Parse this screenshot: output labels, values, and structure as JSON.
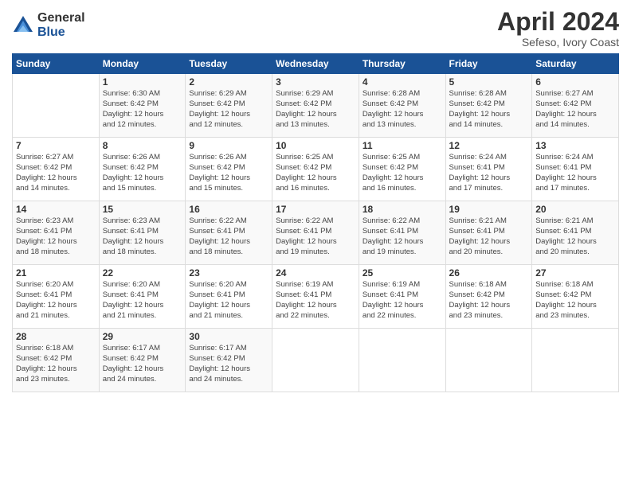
{
  "logo": {
    "general": "General",
    "blue": "Blue"
  },
  "title": "April 2024",
  "location": "Sefeso, Ivory Coast",
  "days_of_week": [
    "Sunday",
    "Monday",
    "Tuesday",
    "Wednesday",
    "Thursday",
    "Friday",
    "Saturday"
  ],
  "weeks": [
    [
      {
        "day": "",
        "info": ""
      },
      {
        "day": "1",
        "info": "Sunrise: 6:30 AM\nSunset: 6:42 PM\nDaylight: 12 hours\nand 12 minutes."
      },
      {
        "day": "2",
        "info": "Sunrise: 6:29 AM\nSunset: 6:42 PM\nDaylight: 12 hours\nand 12 minutes."
      },
      {
        "day": "3",
        "info": "Sunrise: 6:29 AM\nSunset: 6:42 PM\nDaylight: 12 hours\nand 13 minutes."
      },
      {
        "day": "4",
        "info": "Sunrise: 6:28 AM\nSunset: 6:42 PM\nDaylight: 12 hours\nand 13 minutes."
      },
      {
        "day": "5",
        "info": "Sunrise: 6:28 AM\nSunset: 6:42 PM\nDaylight: 12 hours\nand 14 minutes."
      },
      {
        "day": "6",
        "info": "Sunrise: 6:27 AM\nSunset: 6:42 PM\nDaylight: 12 hours\nand 14 minutes."
      }
    ],
    [
      {
        "day": "7",
        "info": "Sunrise: 6:27 AM\nSunset: 6:42 PM\nDaylight: 12 hours\nand 14 minutes."
      },
      {
        "day": "8",
        "info": "Sunrise: 6:26 AM\nSunset: 6:42 PM\nDaylight: 12 hours\nand 15 minutes."
      },
      {
        "day": "9",
        "info": "Sunrise: 6:26 AM\nSunset: 6:42 PM\nDaylight: 12 hours\nand 15 minutes."
      },
      {
        "day": "10",
        "info": "Sunrise: 6:25 AM\nSunset: 6:42 PM\nDaylight: 12 hours\nand 16 minutes."
      },
      {
        "day": "11",
        "info": "Sunrise: 6:25 AM\nSunset: 6:42 PM\nDaylight: 12 hours\nand 16 minutes."
      },
      {
        "day": "12",
        "info": "Sunrise: 6:24 AM\nSunset: 6:41 PM\nDaylight: 12 hours\nand 17 minutes."
      },
      {
        "day": "13",
        "info": "Sunrise: 6:24 AM\nSunset: 6:41 PM\nDaylight: 12 hours\nand 17 minutes."
      }
    ],
    [
      {
        "day": "14",
        "info": "Sunrise: 6:23 AM\nSunset: 6:41 PM\nDaylight: 12 hours\nand 18 minutes."
      },
      {
        "day": "15",
        "info": "Sunrise: 6:23 AM\nSunset: 6:41 PM\nDaylight: 12 hours\nand 18 minutes."
      },
      {
        "day": "16",
        "info": "Sunrise: 6:22 AM\nSunset: 6:41 PM\nDaylight: 12 hours\nand 18 minutes."
      },
      {
        "day": "17",
        "info": "Sunrise: 6:22 AM\nSunset: 6:41 PM\nDaylight: 12 hours\nand 19 minutes."
      },
      {
        "day": "18",
        "info": "Sunrise: 6:22 AM\nSunset: 6:41 PM\nDaylight: 12 hours\nand 19 minutes."
      },
      {
        "day": "19",
        "info": "Sunrise: 6:21 AM\nSunset: 6:41 PM\nDaylight: 12 hours\nand 20 minutes."
      },
      {
        "day": "20",
        "info": "Sunrise: 6:21 AM\nSunset: 6:41 PM\nDaylight: 12 hours\nand 20 minutes."
      }
    ],
    [
      {
        "day": "21",
        "info": "Sunrise: 6:20 AM\nSunset: 6:41 PM\nDaylight: 12 hours\nand 21 minutes."
      },
      {
        "day": "22",
        "info": "Sunrise: 6:20 AM\nSunset: 6:41 PM\nDaylight: 12 hours\nand 21 minutes."
      },
      {
        "day": "23",
        "info": "Sunrise: 6:20 AM\nSunset: 6:41 PM\nDaylight: 12 hours\nand 21 minutes."
      },
      {
        "day": "24",
        "info": "Sunrise: 6:19 AM\nSunset: 6:41 PM\nDaylight: 12 hours\nand 22 minutes."
      },
      {
        "day": "25",
        "info": "Sunrise: 6:19 AM\nSunset: 6:41 PM\nDaylight: 12 hours\nand 22 minutes."
      },
      {
        "day": "26",
        "info": "Sunrise: 6:18 AM\nSunset: 6:42 PM\nDaylight: 12 hours\nand 23 minutes."
      },
      {
        "day": "27",
        "info": "Sunrise: 6:18 AM\nSunset: 6:42 PM\nDaylight: 12 hours\nand 23 minutes."
      }
    ],
    [
      {
        "day": "28",
        "info": "Sunrise: 6:18 AM\nSunset: 6:42 PM\nDaylight: 12 hours\nand 23 minutes."
      },
      {
        "day": "29",
        "info": "Sunrise: 6:17 AM\nSunset: 6:42 PM\nDaylight: 12 hours\nand 24 minutes."
      },
      {
        "day": "30",
        "info": "Sunrise: 6:17 AM\nSunset: 6:42 PM\nDaylight: 12 hours\nand 24 minutes."
      },
      {
        "day": "",
        "info": ""
      },
      {
        "day": "",
        "info": ""
      },
      {
        "day": "",
        "info": ""
      },
      {
        "day": "",
        "info": ""
      }
    ]
  ]
}
